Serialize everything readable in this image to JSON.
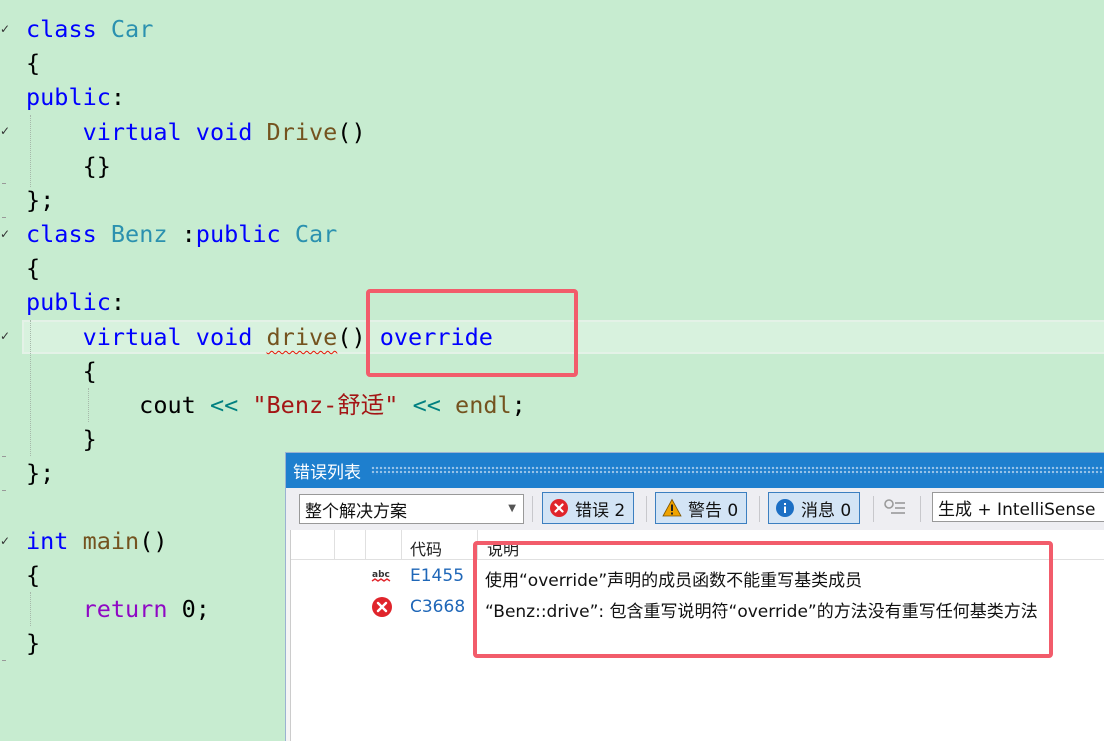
{
  "editor": {
    "lines": {
      "l1": [
        "class",
        " ",
        "Car"
      ],
      "l2": [
        "{"
      ],
      "l3": [
        "public",
        ":"
      ],
      "l4": [
        "    ",
        "virtual",
        " ",
        "void",
        " ",
        "Drive",
        "()"
      ],
      "l5": [
        "    {}"
      ],
      "l6": [
        "};"
      ],
      "l7": [
        "class",
        " ",
        "Benz",
        " :",
        "public",
        " ",
        "Car"
      ],
      "l8": [
        "{"
      ],
      "l9": [
        "public",
        ":"
      ],
      "l10": [
        "    ",
        "virtual",
        " ",
        "void",
        " ",
        "drive",
        "() ",
        "override"
      ],
      "l11": [
        "    {"
      ],
      "l12": [
        "        cout ",
        "<<",
        " ",
        "\"Benz-舒适\"",
        " ",
        "<<",
        " ",
        "endl",
        ";"
      ],
      "l13": [
        "    }"
      ],
      "l14": [
        "};"
      ],
      "l16": [
        "int",
        " ",
        "main",
        "()"
      ],
      "l17": [
        "{"
      ],
      "l18": [
        "    ",
        "return",
        " 0;"
      ],
      "l19": [
        "}"
      ]
    }
  },
  "error_list": {
    "title": "错误列表",
    "scope_dropdown": "整个解决方案",
    "filters": {
      "errors_label": "错误 2",
      "warnings_label": "警告 0",
      "messages_label": "消息 0"
    },
    "build_dropdown": "生成 + IntelliSense",
    "columns": {
      "code": "代码",
      "description": "说明"
    },
    "rows": [
      {
        "icon": "spelling-abc-icon",
        "code": "E1455",
        "description": "使用“override”声明的成员函数不能重写基类成员"
      },
      {
        "icon": "error-circle-icon",
        "code": "C3668",
        "description": "“Benz::drive”: 包含重写说明符“override”的方法没有重写任何基类方法"
      }
    ]
  },
  "colors": {
    "editor_background": "#c7ecd0",
    "keyword": "#0000ff",
    "type": "#2b91af",
    "function": "#74531f",
    "string": "#a31515",
    "highlight_box": "#f25c6b",
    "titlebar": "#1e7fce",
    "error_red": "#e0242b"
  }
}
